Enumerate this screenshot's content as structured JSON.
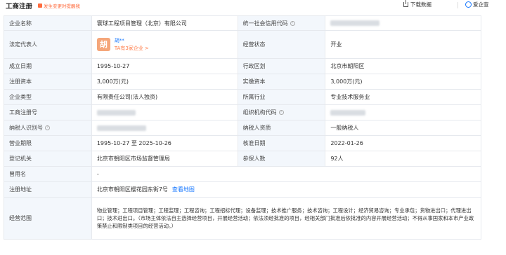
{
  "header": {
    "title": "工商注册",
    "alert": "发生变更时提醒我",
    "download": "下载数据",
    "qcc": "爱企查"
  },
  "rows": {
    "name": {
      "label": "企业名称",
      "value": "寰球工程项目管理（北京）有限公司",
      "label2": "统一社会信用代码"
    },
    "rep": {
      "label": "法定代表人",
      "avatar": "胡",
      "name": "胡**",
      "link": "TA有3家企业 >",
      "label2": "经营状态",
      "value2": "开业"
    },
    "date": {
      "label": "成立日期",
      "value": "1995-10-27",
      "label2": "行政区划",
      "value2": "北京市朝阳区"
    },
    "capital": {
      "label": "注册资本",
      "value": "3,000万(元)",
      "label2": "实缴资本",
      "value2": "3,000万(元)"
    },
    "type": {
      "label": "企业类型",
      "value": "有限责任公司(法人独资)",
      "label2": "所属行业",
      "value2": "专业技术服务业"
    },
    "regno": {
      "label": "工商注册号",
      "label2": "组织机构代码"
    },
    "taxid": {
      "label": "纳税人识别号",
      "label2": "纳税人资质",
      "value2": "一般纳税人"
    },
    "term": {
      "label": "营业期限",
      "value": "1995-10-27 至 2025-10-26",
      "label2": "核准日期",
      "value2": "2022-01-26"
    },
    "authority": {
      "label": "登记机关",
      "value": "北京市朝阳区市场监督管理局",
      "label2": "参保人数",
      "value2": "92人"
    },
    "former": {
      "label": "曾用名",
      "value": "-"
    },
    "address": {
      "label": "注册地址",
      "value": "北京市朝阳区樱花园东街7号",
      "link": "查看地图"
    },
    "scope": {
      "label": "经营范围",
      "value": "物业管理；工程项目管理；工程监理；工程咨询；工程招标代理；设备监理；技术推广服务；技术咨询；工程设计；经济贸易咨询；专业承包；货物进出口；代理进出口；技术进出口。（市场主体依法自主选择经营项目，开展经营活动；依法须经批准的项目，经相关部门批准后依批准的内容开展经营活动；不得从事国家和本市产业政策禁止和限制类项目的经营活动。）"
    }
  }
}
